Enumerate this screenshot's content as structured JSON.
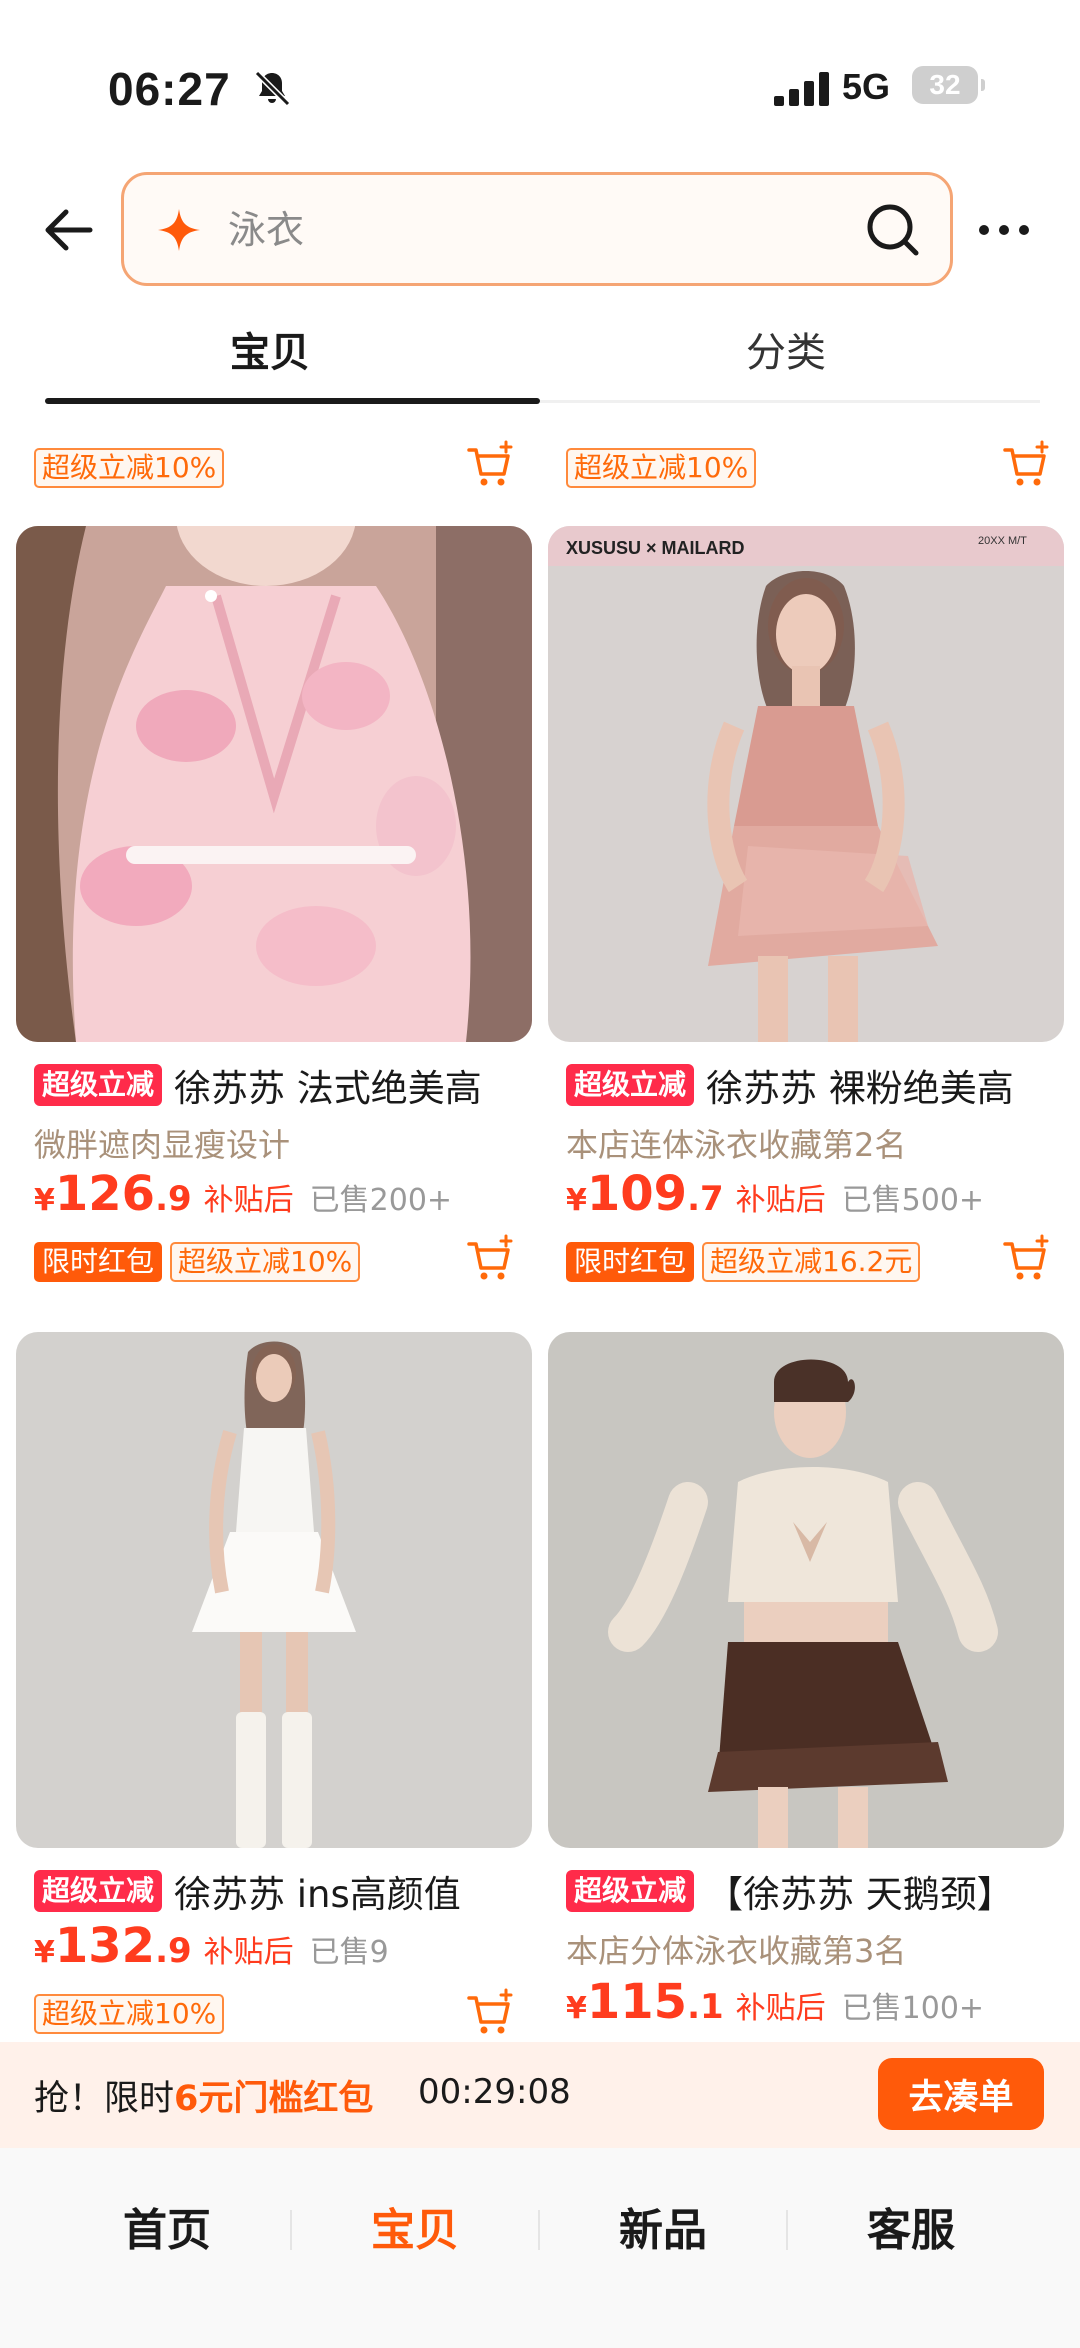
{
  "status_bar": {
    "time": "06:27",
    "network": "5G",
    "battery": "32"
  },
  "search": {
    "placeholder": "泳衣"
  },
  "tabs": [
    {
      "label": "宝贝",
      "active": true
    },
    {
      "label": "分类",
      "active": false
    }
  ],
  "top_partial": {
    "left_tag": "超级立减10%",
    "right_tag": "超级立减10%"
  },
  "products": [
    {
      "promo_tag": "超级立减",
      "title": "徐苏苏 法式绝美高",
      "subtitle": "微胖遮肉显瘦设计",
      "price_yen": "¥",
      "price_int": "126",
      "price_dec": ".9",
      "after_subsidy": "补贴后",
      "sold": "已售200+",
      "tags": [
        "限时红包",
        "超级立减10%"
      ]
    },
    {
      "promo_tag": "超级立减",
      "title": "徐苏苏 裸粉绝美高",
      "subtitle": "本店连体泳衣收藏第2名",
      "image_brand": "XUSUSU × MAILARD",
      "image_note": "20XX M/T",
      "price_yen": "¥",
      "price_int": "109",
      "price_dec": ".7",
      "after_subsidy": "补贴后",
      "sold": "已售500+",
      "tags": [
        "限时红包",
        "超级立减16.2元"
      ]
    },
    {
      "promo_tag": "超级立减",
      "title": "徐苏苏 ins高颜值",
      "price_yen": "¥",
      "price_int": "132",
      "price_dec": ".9",
      "after_subsidy": "补贴后",
      "sold": "已售9",
      "tags": [
        "超级立减10%"
      ]
    },
    {
      "promo_tag": "超级立减",
      "title": "【徐苏苏 天鹅颈】",
      "subtitle": "本店分体泳衣收藏第3名",
      "price_yen": "¥",
      "price_int": "115",
      "price_dec": ".1",
      "after_subsidy": "补贴后",
      "sold": "已售100+"
    }
  ],
  "coupon": {
    "prefix": "抢！限时",
    "highlight": "6元门槛红包",
    "countdown": "00:29:08",
    "button": "去凑单"
  },
  "bottom_nav": [
    {
      "label": "首页",
      "active": false
    },
    {
      "label": "宝贝",
      "active": true
    },
    {
      "label": "新品",
      "active": false
    },
    {
      "label": "客服",
      "active": false
    }
  ],
  "colors": {
    "accent": "#ff5a0a",
    "price": "#ff3c1e",
    "promo_tag": "#ff2b4a",
    "search_border": "#f5a574"
  }
}
